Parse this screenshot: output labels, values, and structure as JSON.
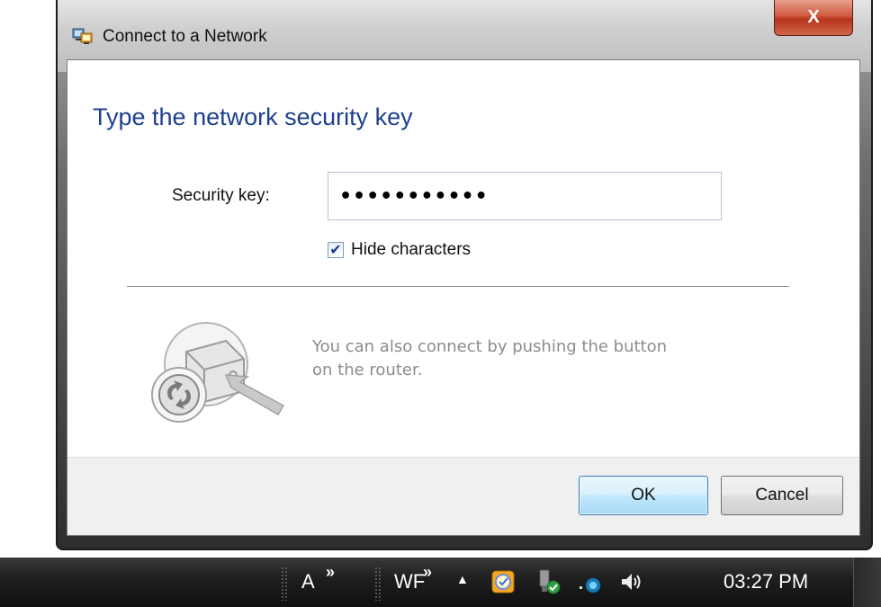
{
  "dialog": {
    "title": "Connect to a Network",
    "heading": "Type the network security key",
    "security_key_label": "Security key:",
    "security_key_value": "•••••••••••",
    "hide_characters_label": "Hide characters",
    "hide_characters_checked": true,
    "wps_text": "You can also connect by pushing the button on the router.",
    "ok_label": "OK",
    "cancel_label": "Cancel",
    "close_glyph": "X"
  },
  "taskbar": {
    "toolbar_a_label": "A",
    "toolbar_wf_label": "WF",
    "chevron_glyph": "»",
    "tray_expand_glyph": "▲",
    "clock": "03:27 PM",
    "tray_icons": [
      "outlook-icon",
      "usb-device-icon",
      "network-icon",
      "volume-icon"
    ]
  },
  "colors": {
    "heading": "#1e3f8f",
    "close_button": "#c7482c",
    "ok_border": "#3c7fb1",
    "wps_text": "#8c8c8c"
  }
}
